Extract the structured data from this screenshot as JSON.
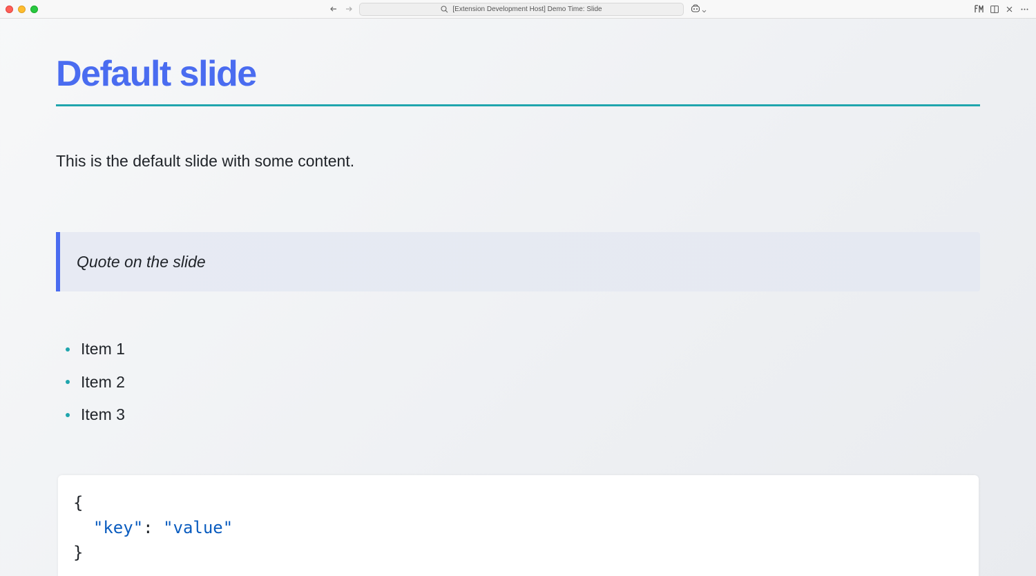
{
  "window": {
    "search_text": "[Extension Development Host] Demo Time: Slide"
  },
  "toolbar": {
    "icons": [
      "arrow-left-icon",
      "arrow-right-icon",
      "search-icon",
      "copilot-icon",
      "chevron-down-icon",
      "font-icon",
      "split-editor-icon",
      "close-icon",
      "more-icon"
    ]
  },
  "slide": {
    "title": "Default slide",
    "intro": "This is the default slide with some content.",
    "quote": "Quote on the slide",
    "bullets": [
      "Item 1",
      "Item 2",
      "Item 3"
    ],
    "code": {
      "open": "{",
      "key": "\"key\"",
      "sep": ": ",
      "value": "\"value\"",
      "close": "}"
    }
  },
  "colors": {
    "title": "#4a6cf0",
    "rule": "#1fa5ad",
    "quote_border": "#4a6cf0",
    "bullet": "#1fa5ad",
    "code_token": "#0a5cbf"
  }
}
